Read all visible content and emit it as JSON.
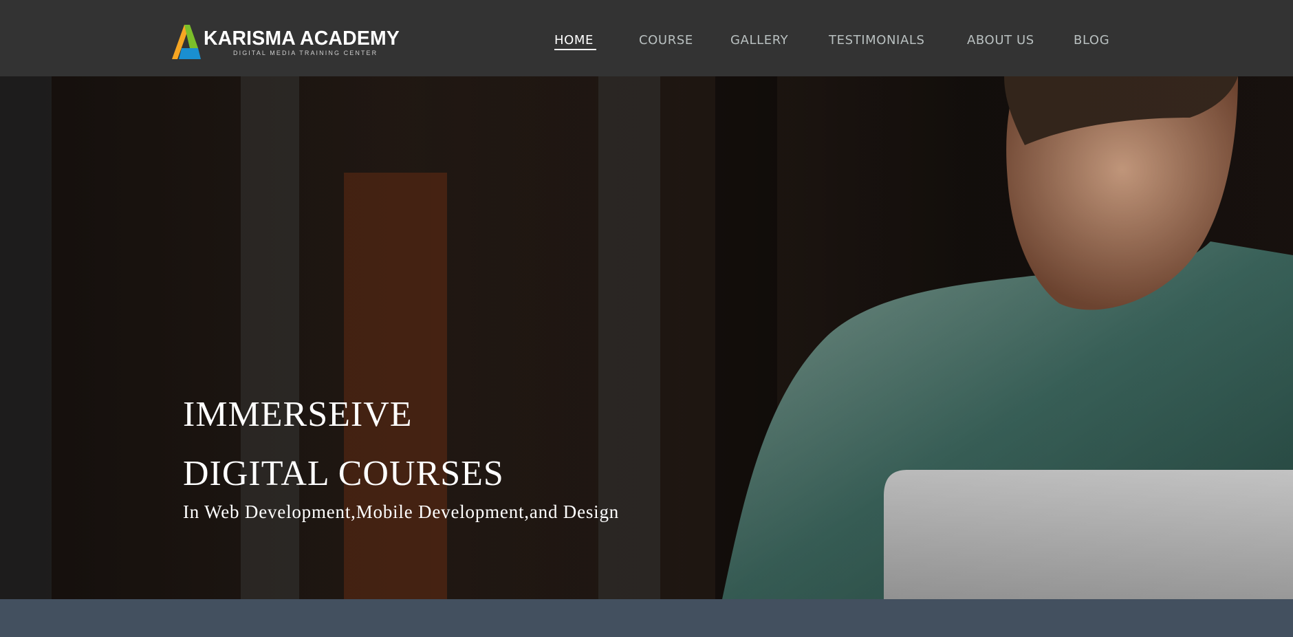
{
  "brand": {
    "name": "KARISMA ACADEMY",
    "tagline": "DIGITAL MEDIA TRAINING CENTER",
    "logo_colors": [
      "#f5a623",
      "#7bbf2a",
      "#1a8fd0"
    ]
  },
  "nav": {
    "items": [
      {
        "label": "HOME",
        "active": true
      },
      {
        "label": "COURSE",
        "active": false
      },
      {
        "label": "GALLERY",
        "active": false
      },
      {
        "label": "TESTIMONIALS",
        "active": false
      },
      {
        "label": "ABOUT US",
        "active": false
      },
      {
        "label": "BLOG",
        "active": false
      }
    ]
  },
  "hero": {
    "line1": "IMMERSEIVE",
    "line2": "DIGITAL COURSES",
    "subtitle": "In Web Development,Mobile Development,and Design"
  },
  "colors": {
    "navbar_bg": "#333333",
    "nav_text": "#b9c0c0",
    "nav_active": "#ffffff",
    "bottom_bar": "#43505f"
  }
}
